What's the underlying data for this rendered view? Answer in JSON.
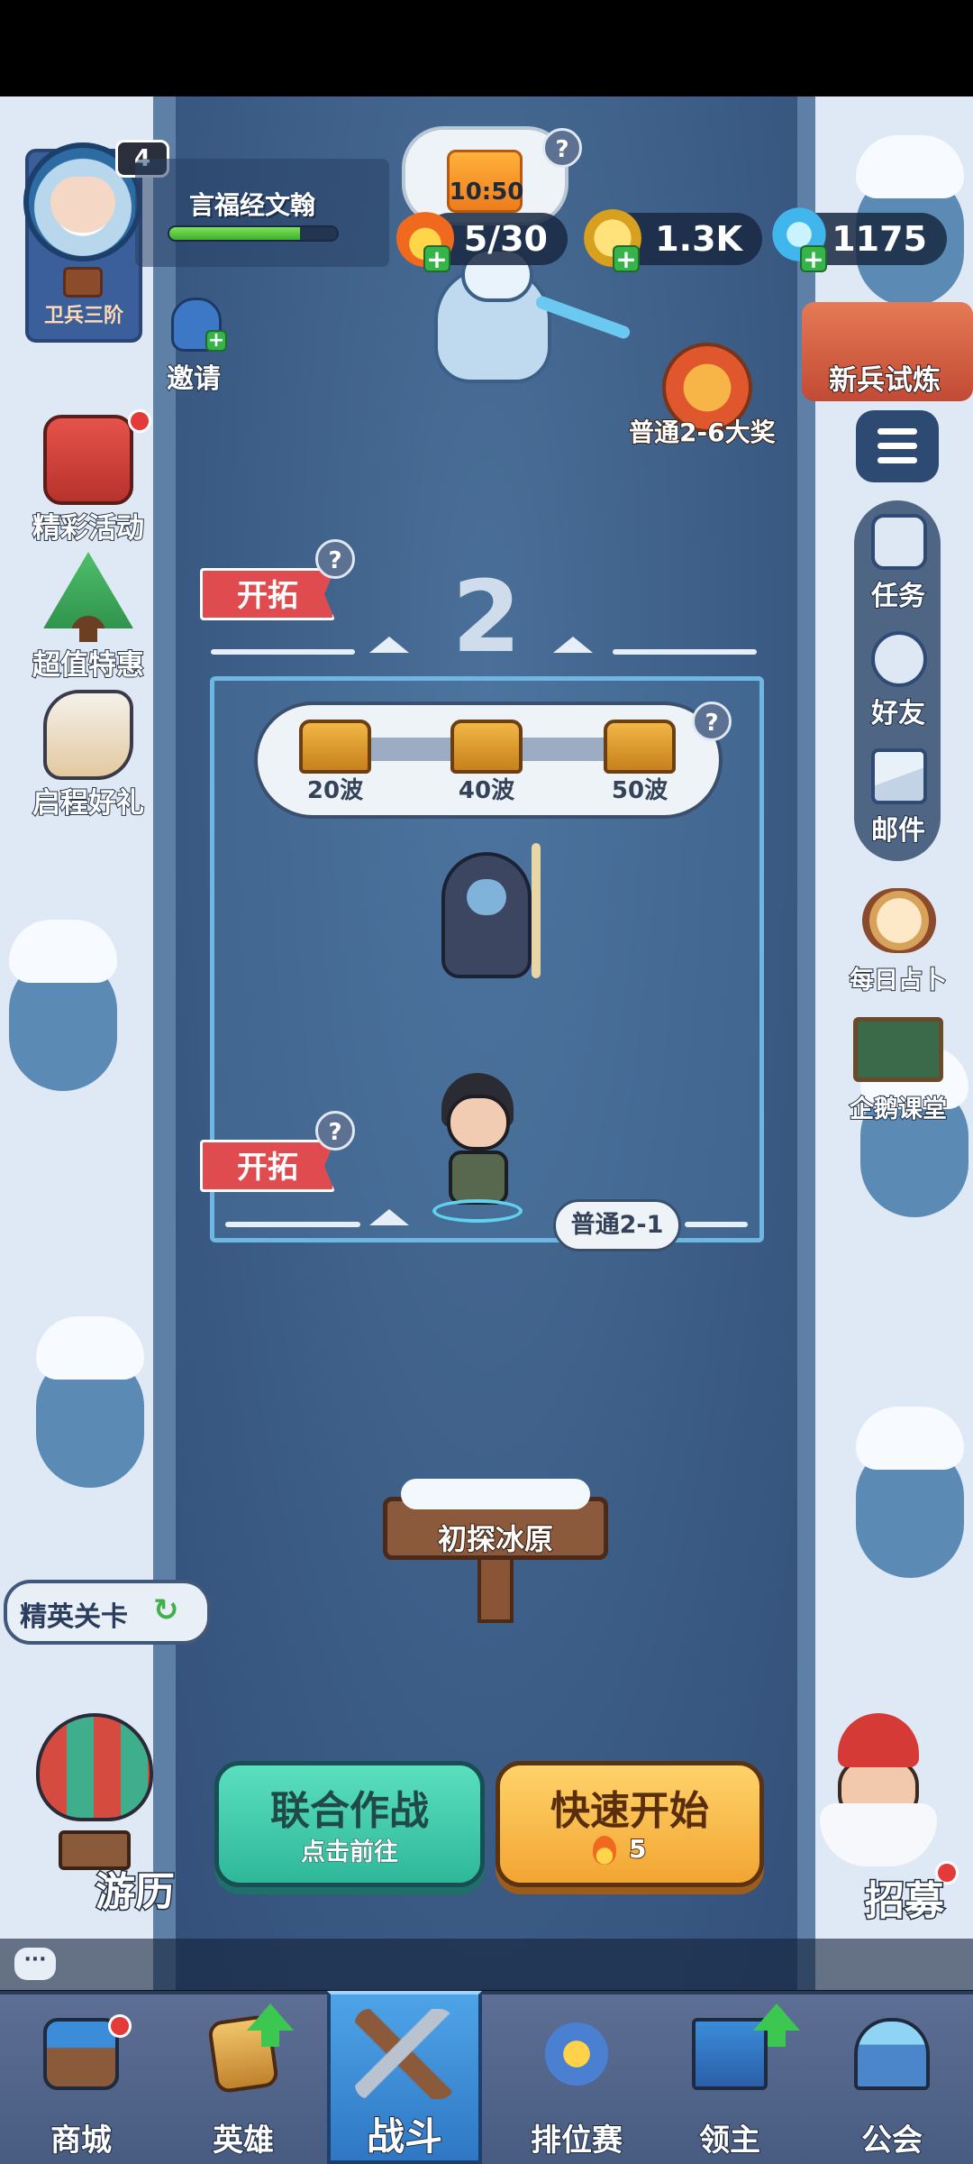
{
  "player": {
    "level": "4",
    "name": "言福经文翰",
    "rank": "卫兵三阶",
    "exp_fraction": 0.78
  },
  "energy_timer": "10:50",
  "currencies": {
    "stamina": "5/30",
    "gold": "1.3K",
    "gems": "1175"
  },
  "invite_label": "邀请",
  "left_menu": [
    {
      "label": "精彩活动"
    },
    {
      "label": "超值特惠"
    },
    {
      "label": "启程好礼"
    }
  ],
  "right_top": {
    "trial_label": "新兵试炼",
    "prize_label": "普通2-6大奖"
  },
  "right_menu": [
    {
      "label": "任务"
    },
    {
      "label": "好友"
    },
    {
      "label": "邮件"
    },
    {
      "label": "每日占卜"
    },
    {
      "label": "企鹅课堂"
    }
  ],
  "stage": {
    "number": "2",
    "explore_label": "开拓",
    "wave_rewards": [
      "20波",
      "40波",
      "50波"
    ],
    "stage_tag": "普通2-1",
    "signpost": "初探冰原"
  },
  "elite_label": "精英关卡",
  "journey_label": "游历",
  "recruit_label": "招募",
  "buttons": {
    "coop_title": "联合作战",
    "coop_sub": "点击前往",
    "quick_title": "快速开始",
    "quick_cost": "5"
  },
  "bottom_nav": [
    {
      "label": "商城"
    },
    {
      "label": "英雄"
    },
    {
      "label": "战斗"
    },
    {
      "label": "排位赛"
    },
    {
      "label": "领主"
    },
    {
      "label": "公会"
    }
  ],
  "colors": {
    "river": "#3c5d86",
    "snow": "#dfe9f5",
    "accent_red": "#e04b50",
    "coop_green": "#2fb79a",
    "quick_orange": "#f2a532",
    "nav_active": "#2f77c4"
  }
}
